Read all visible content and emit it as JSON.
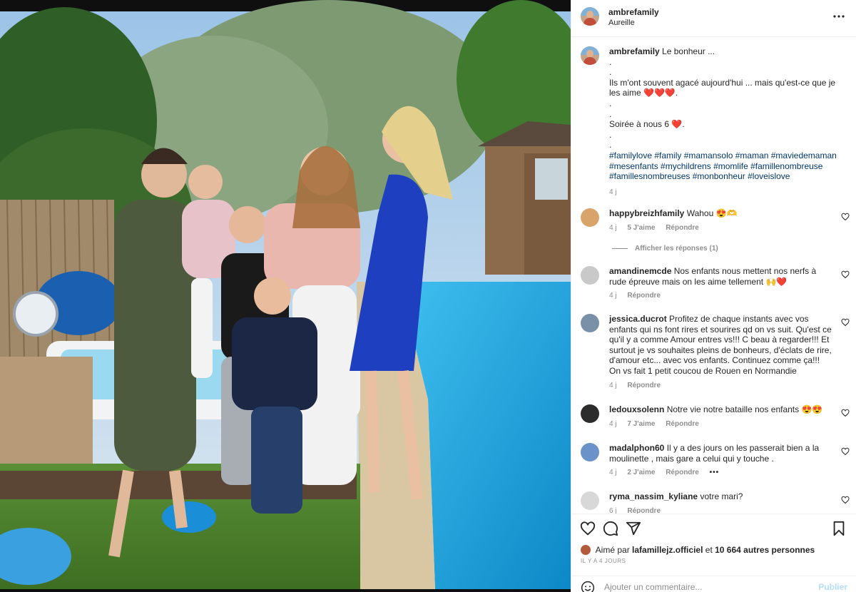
{
  "header": {
    "username": "ambrefamily",
    "location": "Aureille"
  },
  "caption": {
    "username": "ambrefamily",
    "lines": [
      "Le bonheur ...",
      ".",
      ".",
      "Ils m'ont souvent agacé aujourd'hui ... mais qu'est-ce que je les aime ❤️❤️❤️.",
      ".",
      ".",
      "Soirée à nous 6 ❤️.",
      ".",
      "."
    ],
    "hashtags": "#familylove #family #mamansolo #maman #maviedemaman #mesenfants #mychildrens #momlife #famillenombreuse #famillesnombreuses #monbonheur #loveislove",
    "time": "4 j"
  },
  "comments": [
    {
      "username": "happybreizhfamily",
      "text": "Wahou 😍🫶",
      "time": "4 j",
      "likes": "5 J'aime",
      "reply": "Répondre"
    },
    {
      "username": "amandinemcde",
      "text": "Nos enfants nous mettent nos nerfs à rude épreuve mais on les aime tellement 🙌❤️",
      "time": "4 j",
      "reply": "Répondre"
    },
    {
      "username": "jessica.ducrot",
      "text": "Profitez de chaque instants avec vos enfants qui ns font rires et sourires qd on vs suit. Qu'est ce qu'il y a comme Amour entres vs!!! C beau à regarder!!! Et surtout je vs souhaites pleins de bonheurs, d'éclats de rire, d'amour etc... avec vos enfants. Continuez comme ça!!! On vs fait 1 petit coucou de Rouen en Normandie",
      "time": "4 j",
      "reply": "Répondre"
    },
    {
      "username": "ledouxsolenn",
      "text": "Notre vie notre bataille nos enfants 😍😍",
      "time": "4 j",
      "likes": "7 J'aime",
      "reply": "Répondre"
    },
    {
      "username": "madalphon60",
      "text": "Il y a des jours on les passerait bien a la moulinette , mais gare a celui qui y touche .",
      "time": "4 j",
      "likes": "2 J'aime",
      "reply": "Répondre",
      "more": "•••"
    },
    {
      "username": "ryma_nassim_kyliane",
      "text": "votre mari?",
      "time": "6 j",
      "reply": "Répondre"
    }
  ],
  "replies_toggle": "Afficher les réponses (1)",
  "likes": {
    "prefix": "Aimé par",
    "user": "lafamillejz.officiel",
    "and": "et",
    "others": "10 664 autres personnes"
  },
  "posted_ago": "IL Y A 4 JOURS",
  "add_comment": {
    "placeholder": "Ajouter un commentaire...",
    "publish": "Publier"
  },
  "icons": [
    "more-icon",
    "heart-icon",
    "comment-icon",
    "share-icon",
    "bookmark-icon",
    "emoji-icon"
  ],
  "colors": {
    "link": "#00376b",
    "muted": "#8e8e8e",
    "publish": "#b2dffc",
    "heart": "#ed4956"
  }
}
